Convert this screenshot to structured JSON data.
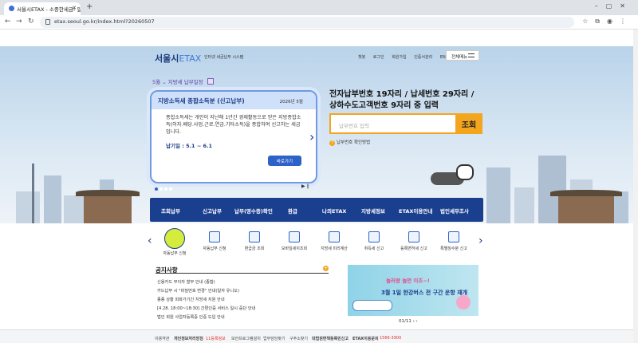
{
  "browser": {
    "tab_title": "서울시ETAX - 소중한세금! 알뜰",
    "url": "etax.seoul.go.kr/index.html?20260507"
  },
  "header": {
    "logo_main": "서울시",
    "logo_etax": "ETAX",
    "logo_sub": "인터넷 세금납부 시스템",
    "links": [
      "챗봇",
      "로그인",
      "회원가입",
      "인증서관리",
      "ENGLISH"
    ],
    "all_menu": "전체메뉴"
  },
  "schedule": {
    "month": "5월",
    "title": "지방세 납부일정"
  },
  "card": {
    "title": "지방소득세 종합소득분 (신고납부)",
    "date": "2026년 5월",
    "body": "종합소득세는 개인이 지난해 1년간 경제활동으로 얻은 지방종합소득(이자.배당.사업.근로.연금.기타소득)을 종합하여 신고하는 세금입니다.",
    "period": "납기일 : 5.1 ~ 6.1",
    "button": "바로가기"
  },
  "payment": {
    "title_line1": "전자납부번호 19자리 / 납세번호 29자리 /",
    "title_line2": "상하수도고객번호 9자리 중 입력",
    "placeholder": "납부번호 입력",
    "button": "조회",
    "help": "납부번호 확인방법"
  },
  "gnb": [
    "조회납부",
    "신고납부",
    "납부(영수증)확인",
    "환급",
    "나의ETAX",
    "지방세정보",
    "ETAX이용안내",
    "법인세무조사"
  ],
  "quick_menu": [
    "자동납부 신청",
    "자동납부 신청",
    "환급금 조회",
    "모바일세지조회",
    "지방세 미리계산",
    "취득세 신고",
    "등록면허세 신고",
    "특별징수분 신고"
  ],
  "notice": {
    "title": "공지사항",
    "items": [
      "신용카드 무이자 할부 안내 (종합)",
      "카드납부 시 \"비밀번호 변경\" 안내(일자 유니오)",
      "종종 상황 회화가기간 지방세 지원 안내",
      "[4.28. 18:00~18:30] 간편인증 서비스 일시 중단 안내",
      "법인 회원 사업자등록증 인증 도입 안내"
    ]
  },
  "banner": {
    "line1": "놀러왕 놀먼 이조~!",
    "line2": "3월 1일 한강버스 전 구간 운항 재개",
    "pager": "01/11 ‹ ›"
  },
  "footer": [
    "이용약관",
    "개인정보처리방침",
    "11등록정보",
    "보안프로그램설치",
    "업무담당찾기",
    "구주소찾기",
    "대법원면책등록민신고",
    "ETAX이용문의",
    "1566-3900"
  ]
}
